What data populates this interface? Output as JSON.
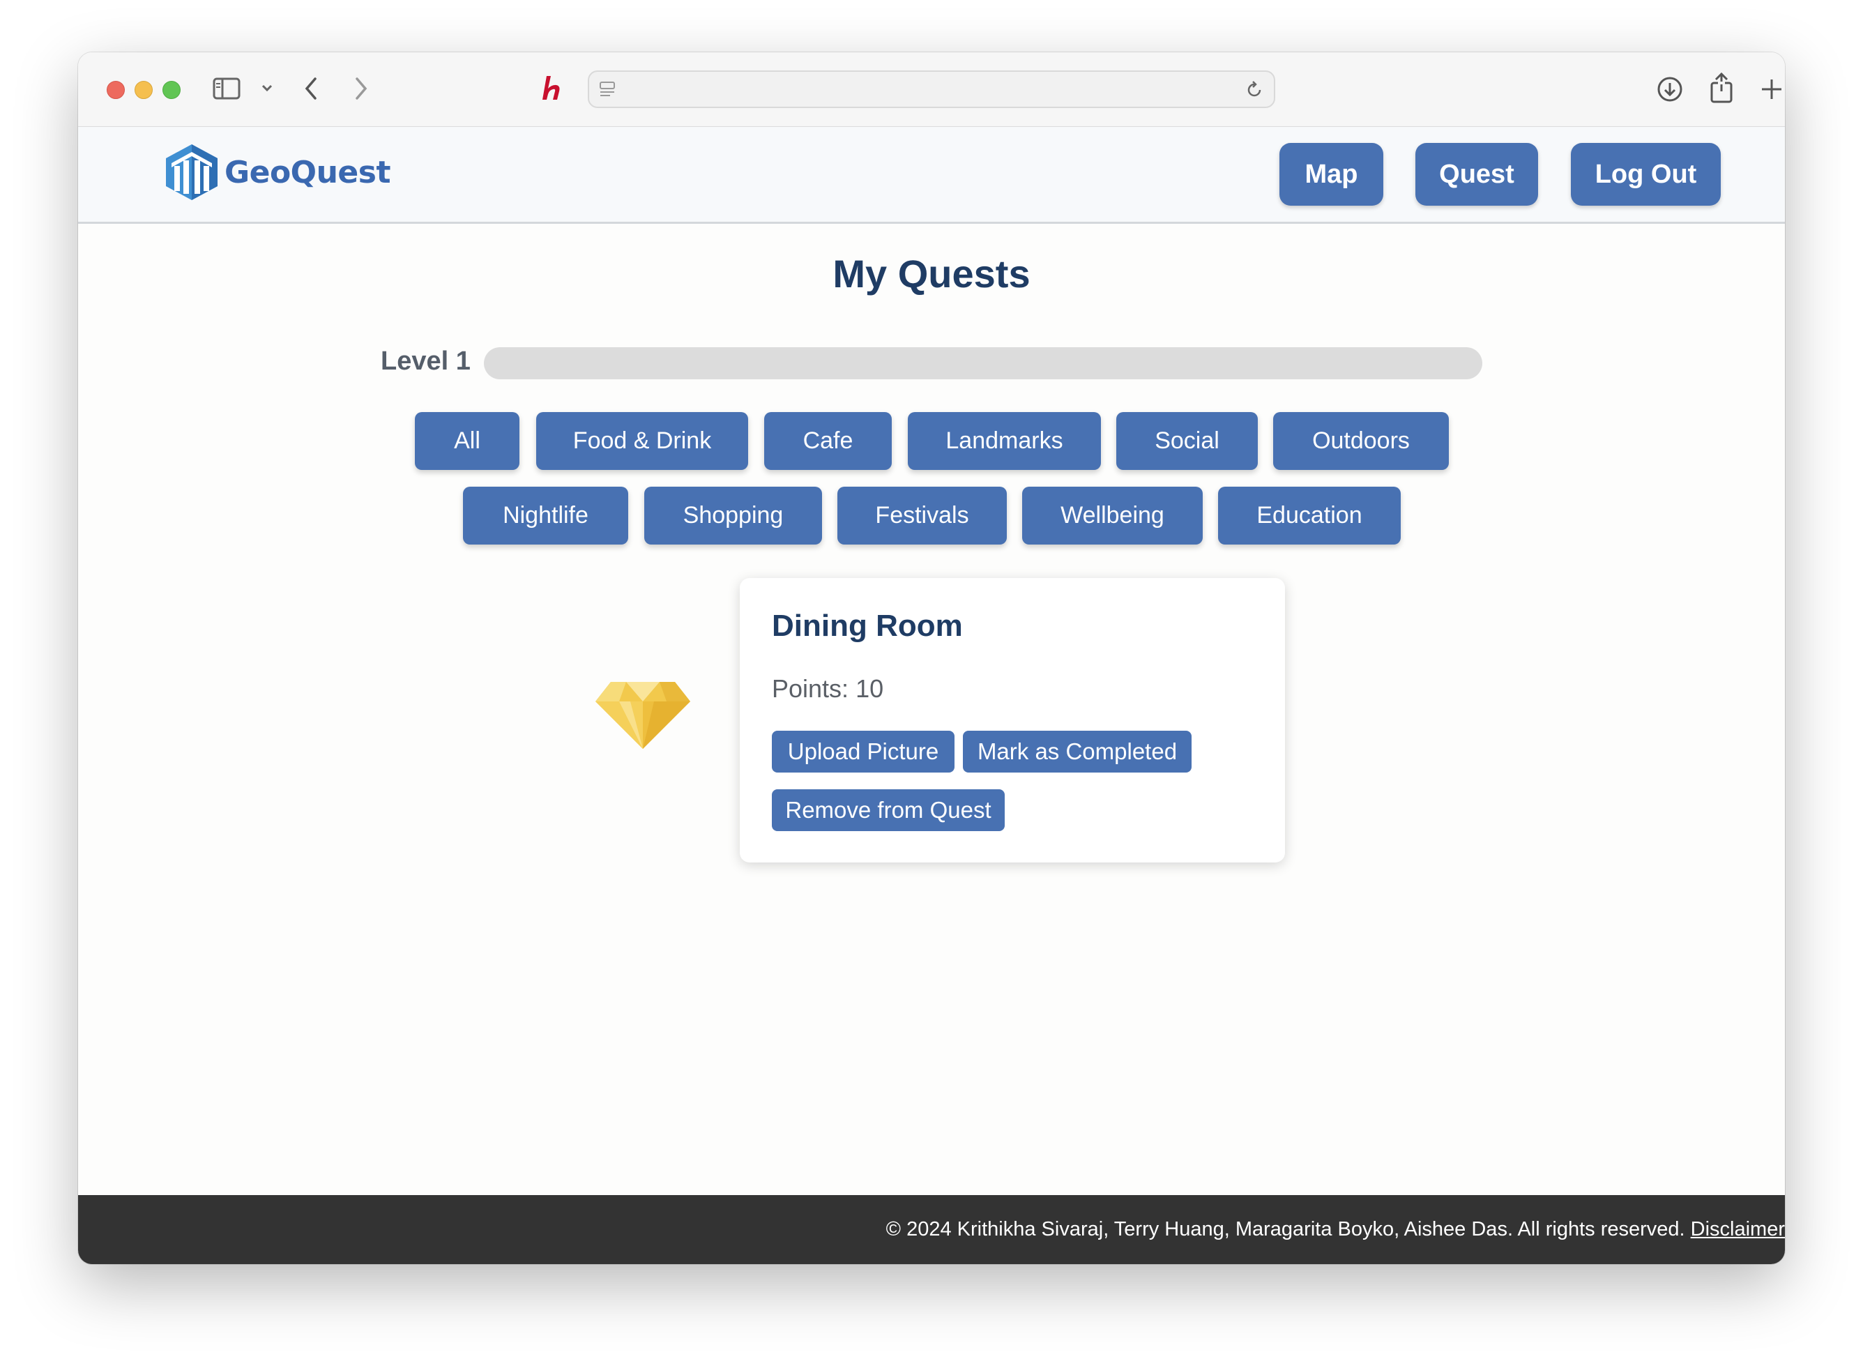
{
  "browser": {
    "url": ""
  },
  "header": {
    "logo_text": "GeoQuest",
    "nav": [
      {
        "label": "Map"
      },
      {
        "label": "Quest"
      },
      {
        "label": "Log Out"
      }
    ]
  },
  "main": {
    "title": "My Quests",
    "level": {
      "label": "Level 1",
      "progress": 0
    },
    "filters": [
      "All",
      "Food & Drink",
      "Cafe",
      "Landmarks",
      "Social",
      "Outdoors",
      "Nightlife",
      "Shopping",
      "Festivals",
      "Wellbeing",
      "Education"
    ],
    "quest_card": {
      "title": "Dining Room",
      "points_label": "Points: ",
      "points_value": "10",
      "actions": {
        "upload": "Upload Picture",
        "complete": "Mark as Completed",
        "remove": "Remove from Quest"
      },
      "icon": "diamond-icon"
    }
  },
  "footer": {
    "copyright": "© 2024 Krithikha Sivaraj, Terry Huang, Maragarita Boyko, Aishee Das. All rights reserved. ",
    "link": "Disclaimer"
  },
  "colors": {
    "primary": "#4871b2",
    "title": "#1f3c64",
    "footer_bg": "#333333",
    "gem": "#f2c94c"
  }
}
